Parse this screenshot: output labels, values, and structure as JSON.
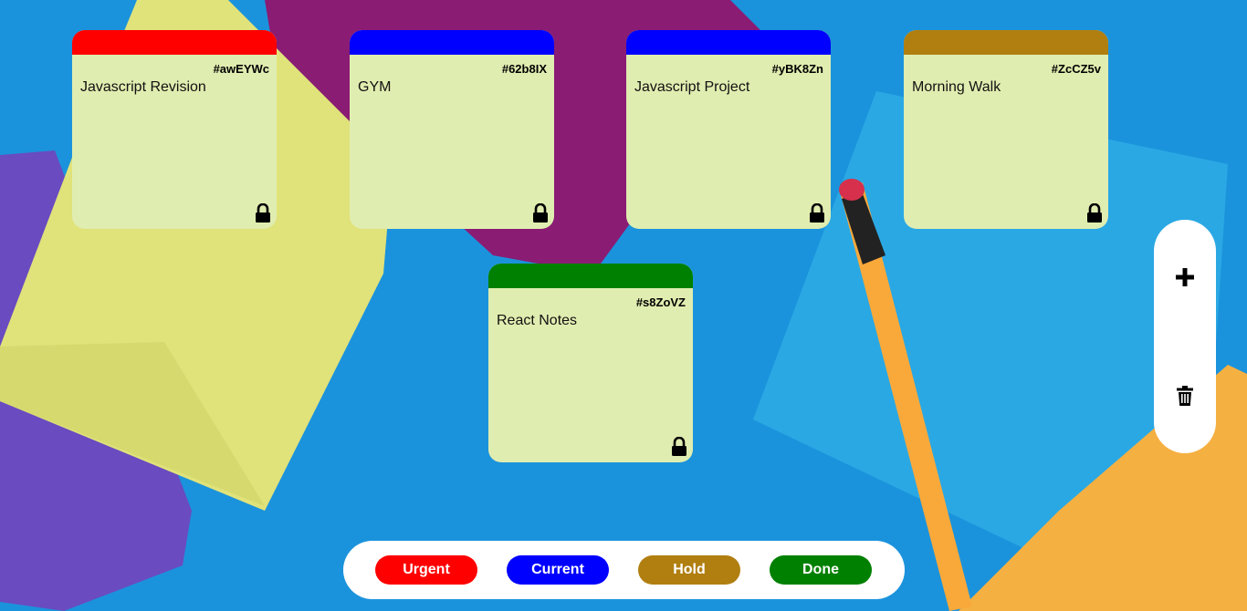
{
  "tickets": [
    {
      "id": "#awEYWc",
      "task": "Javascript Revision",
      "color": "#ff0000"
    },
    {
      "id": "#62b8IX",
      "task": "GYM",
      "color": "#0000ff"
    },
    {
      "id": "#yBK8Zn",
      "task": "Javascript Project",
      "color": "#0000ff"
    },
    {
      "id": "#ZcCZ5v",
      "task": "Morning Walk",
      "color": "#b07f10"
    },
    {
      "id": "#s8ZoVZ",
      "task": "React Notes",
      "color": "#008000"
    }
  ],
  "toolbox": {
    "add_icon": "plus-icon",
    "remove_icon": "trash-icon"
  },
  "filters": [
    {
      "label": "Urgent",
      "color": "#ff0000"
    },
    {
      "label": "Current",
      "color": "#0000ff"
    },
    {
      "label": "Hold",
      "color": "#b07f10"
    },
    {
      "label": "Done",
      "color": "#008000"
    }
  ]
}
